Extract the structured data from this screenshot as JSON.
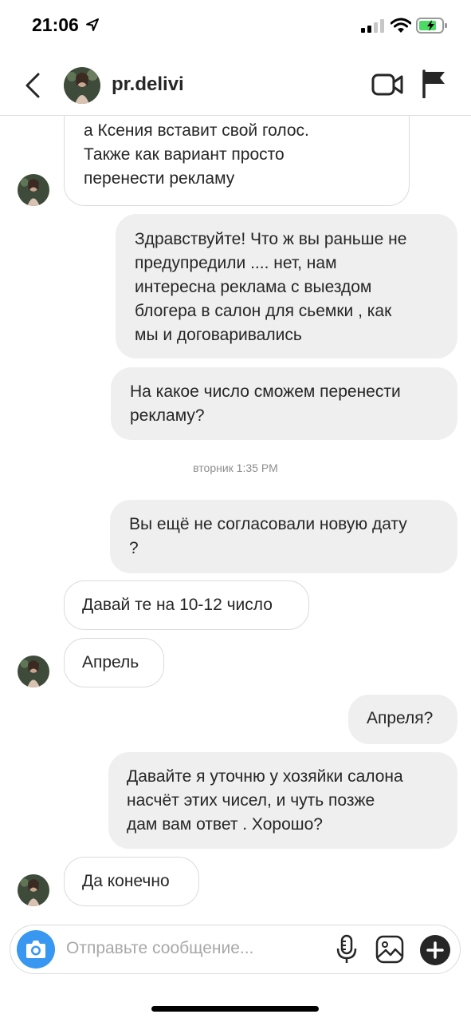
{
  "status_bar": {
    "time": "21:06"
  },
  "header": {
    "username": "pr.delivi"
  },
  "messages": [
    {
      "side": "in",
      "text": "а Ксения вставит свой голос.\nТакже как вариант просто\nперенести рекламу"
    },
    {
      "side": "out",
      "text": "Здравствуйте! Что ж вы раньше не\nпредупредили .... нет, нам\nинтересна реклама с выездом\nблогера в салон для сьемки , как\nмы и договаривались"
    },
    {
      "side": "out",
      "text": "На какое число сможем перенести\nрекламу?"
    },
    {
      "side": "out",
      "text": "Вы ещё не согласовали новую дату\n?"
    },
    {
      "side": "in",
      "text": "Давай те на 10-12 число"
    },
    {
      "side": "in",
      "text": "Апрель"
    },
    {
      "side": "out",
      "text": "Апреля?"
    },
    {
      "side": "out",
      "text": "Давайте я уточню у хозяйки салона\nнасчёт этих чисел, и чуть позже\nдам вам ответ . Хорошо?"
    },
    {
      "side": "in",
      "text": "Да конечно"
    }
  ],
  "divider": {
    "text": "вторник 1:35 PM"
  },
  "composer": {
    "placeholder": "Отправьте сообщение..."
  },
  "icons": {
    "back": "chevron-left-icon",
    "video": "video-camera-icon",
    "flag": "flag-icon",
    "camera": "camera-icon",
    "mic": "microphone-icon",
    "gallery": "image-icon",
    "add": "plus-icon"
  },
  "colors": {
    "accent": "#3897f0",
    "outgoing_bubble": "#efefef",
    "battery": "#4cd964"
  }
}
